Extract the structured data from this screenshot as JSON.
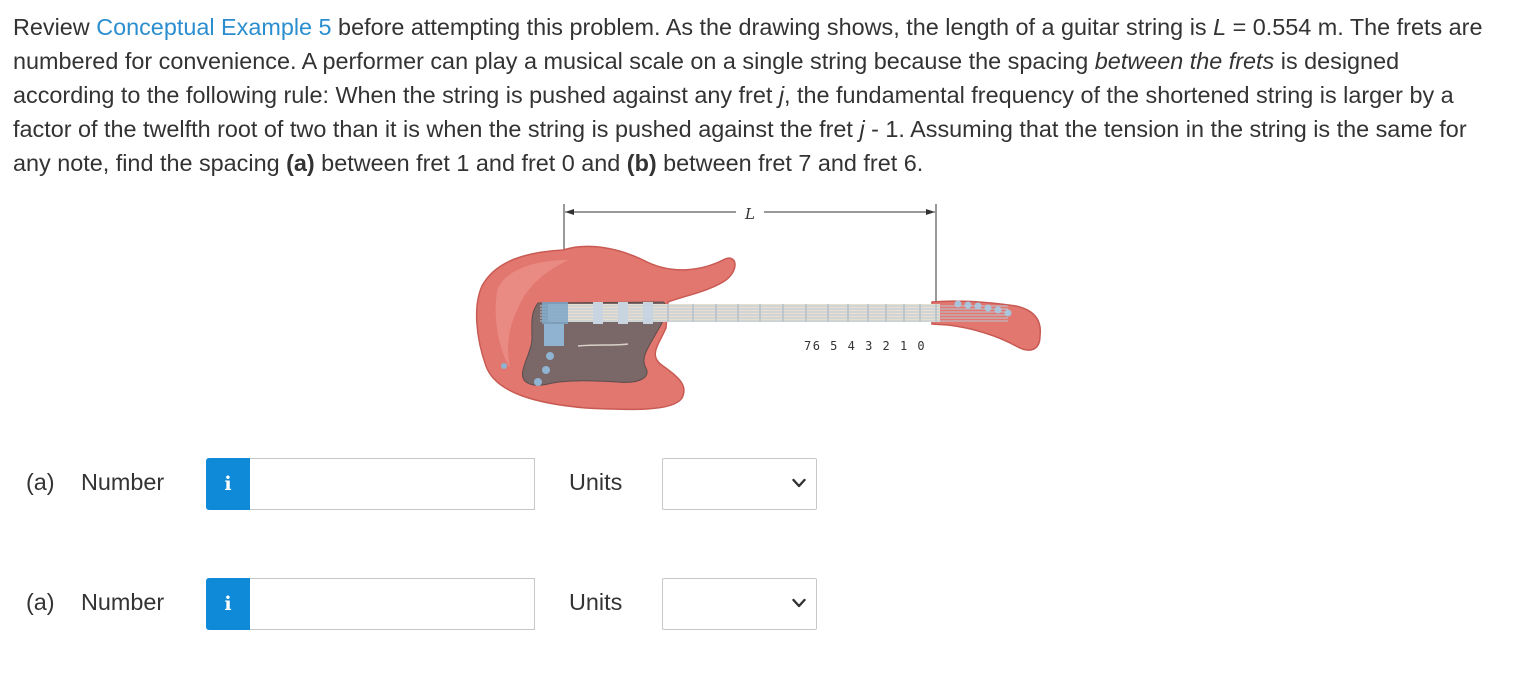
{
  "problem": {
    "p1": "Review ",
    "link": "Conceptual Example 5",
    "p2": " before attempting this problem. As the drawing shows, the length of a guitar string is ",
    "L_var": "L",
    "p3": " = 0.554 m. The frets are numbered for convenience. A performer can play a musical scale on a single string because the spacing ",
    "italic_phrase": "between the frets",
    "p4": " is designed according to the following rule: When the string is pushed against any fret ",
    "j_var1": "j",
    "p5": ", the fundamental frequency of the shortened string is larger by a factor of the twelfth root of two than it is when the string is pushed against the fret ",
    "j_var2": "j",
    "p6": " - 1. Assuming that the tension in the string is the same for any note, find the spacing ",
    "part_a": "(a)",
    "p7": " between fret 1 and fret 0 and ",
    "part_b": "(b)",
    "p8": " between fret 7 and fret 6."
  },
  "figure": {
    "length_label": "L",
    "fret_numbers": "76 5 4 3 2 1 0",
    "colors": {
      "body": "#e2776f",
      "body_shadow": "#c95a53",
      "pickguard": "#7a6868",
      "neck": "#e8dfd0",
      "string": "#b8c8d8",
      "pickup": "#7fa8c9"
    }
  },
  "answers": [
    {
      "part_label": "(a)",
      "number_label": "Number",
      "info_icon": "i",
      "number_value": "",
      "units_label": "Units",
      "units_value": ""
    },
    {
      "part_label": "(a)",
      "number_label": "Number",
      "info_icon": "i",
      "number_value": "",
      "units_label": "Units",
      "units_value": ""
    }
  ],
  "colors": {
    "link": "#2b8ecf",
    "info_button": "#0e8ad9",
    "text": "#333333",
    "input_border": "#c8c8c8"
  }
}
